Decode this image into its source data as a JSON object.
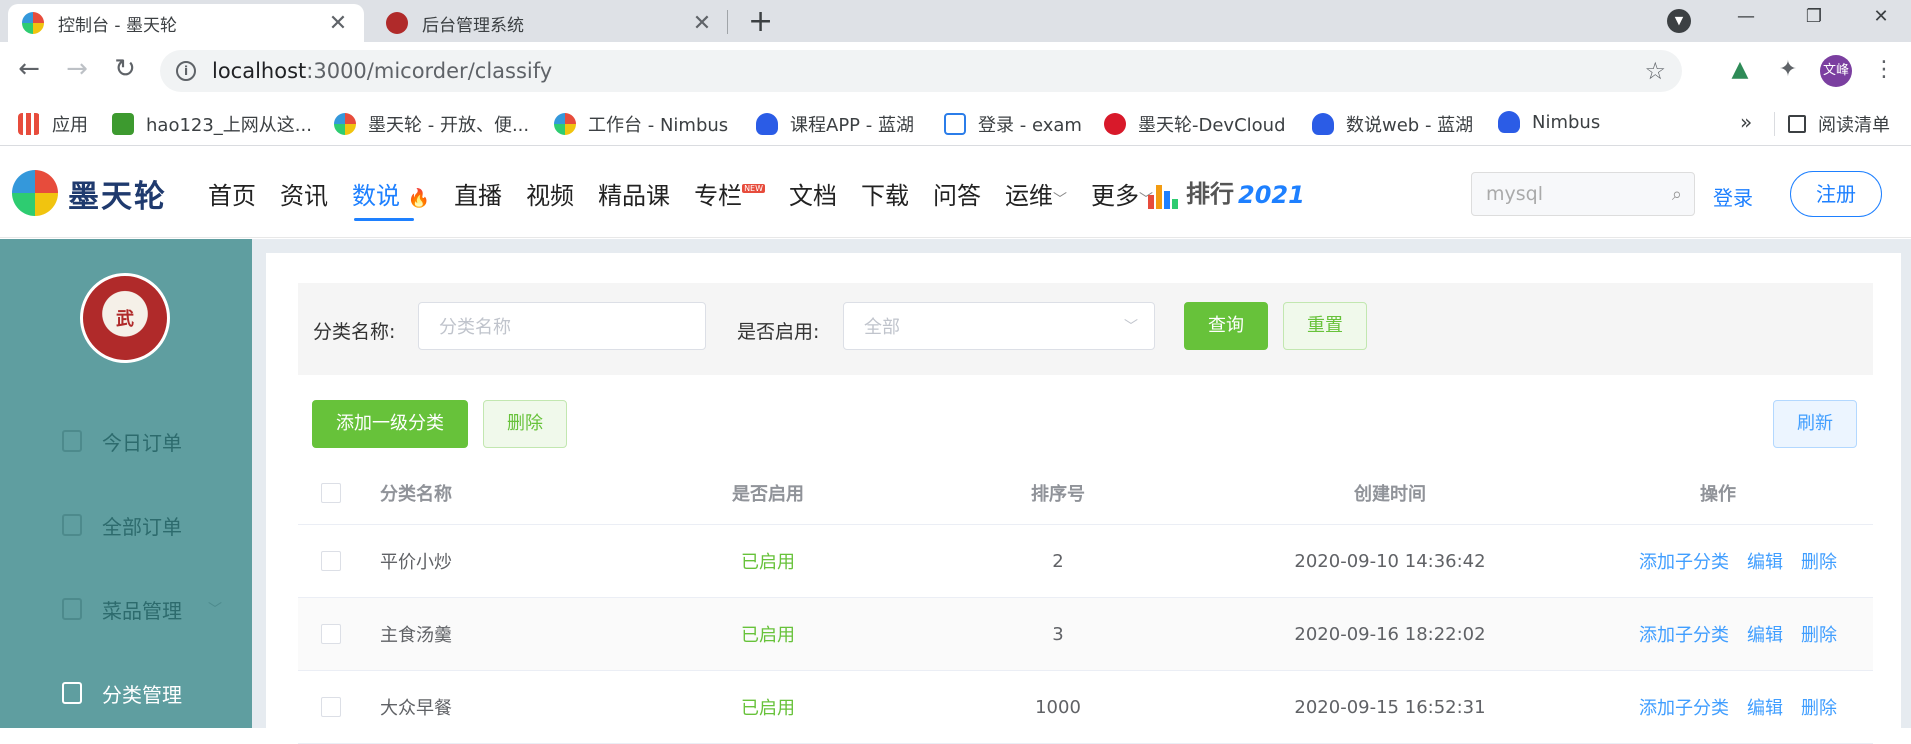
{
  "browser": {
    "tabs": [
      {
        "title": "控制台 - 墨天轮",
        "close": "✕"
      },
      {
        "title": "后台管理系统",
        "close": "✕"
      }
    ],
    "new_tab": "+",
    "window": {
      "minimize": "—",
      "maximize": "❐",
      "close": "✕"
    },
    "url_host": "localhost",
    "url_path": ":3000/micorder/classify",
    "profile_label": "文峰",
    "bookmarks": [
      {
        "label": "应用"
      },
      {
        "label": "hao123_上网从这..."
      },
      {
        "label": "墨天轮 - 开放、便..."
      },
      {
        "label": "工作台 - Nimbus"
      },
      {
        "label": "课程APP - 蓝湖"
      },
      {
        "label": "登录 - exam"
      },
      {
        "label": "墨天轮-DevCloud"
      },
      {
        "label": "数说web - 蓝湖"
      },
      {
        "label": "Nimbus"
      }
    ],
    "bookmarks_more": "»",
    "reading_list": "阅读清单"
  },
  "site": {
    "logo_text": "墨天轮",
    "nav": [
      {
        "label": "首页"
      },
      {
        "label": "资讯"
      },
      {
        "label": "数说"
      },
      {
        "label": "直播"
      },
      {
        "label": "视频"
      },
      {
        "label": "精品课"
      },
      {
        "label": "专栏"
      },
      {
        "label": "文档"
      },
      {
        "label": "下载"
      },
      {
        "label": "问答"
      },
      {
        "label": "运维"
      },
      {
        "label": "更多"
      }
    ],
    "new_badge": "NEW",
    "ranking_text": "排行",
    "ranking_year": "2021",
    "search_placeholder": "mysql",
    "login": "登录",
    "register": "注册",
    "brand_color": "#1e80ff"
  },
  "sidebar": {
    "avatar_text": "武",
    "items": [
      {
        "label": "今日订单"
      },
      {
        "label": "全部订单"
      },
      {
        "label": "菜品管理"
      },
      {
        "label": "分类管理"
      }
    ],
    "color": "#5f9ea0"
  },
  "filter": {
    "name_label": "分类名称:",
    "name_placeholder": "分类名称",
    "enabled_label": "是否启用:",
    "enabled_value": "全部",
    "query": "查询",
    "reset": "重置"
  },
  "actions": {
    "add_top": "添加一级分类",
    "delete": "删除",
    "refresh": "刷新"
  },
  "table": {
    "headers": [
      "分类名称",
      "是否启用",
      "排序号",
      "创建时间",
      "操作"
    ],
    "rows": [
      {
        "name": "平价小炒",
        "enabled": "已启用",
        "sort": "2",
        "created": "2020-09-10 14:36:42"
      },
      {
        "name": "主食汤羹",
        "enabled": "已启用",
        "sort": "3",
        "created": "2020-09-16 18:22:02"
      },
      {
        "name": "大众早餐",
        "enabled": "已启用",
        "sort": "1000",
        "created": "2020-09-15 16:52:31"
      }
    ],
    "ops": {
      "add_child": "添加子分类",
      "edit": "编辑",
      "delete": "删除"
    }
  }
}
